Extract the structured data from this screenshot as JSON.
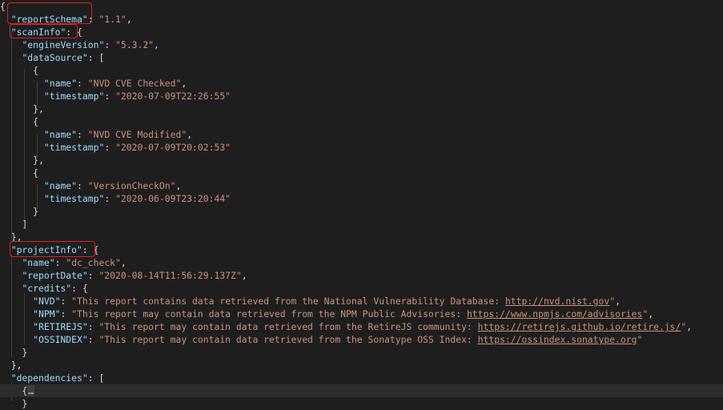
{
  "editor": {
    "lines": [
      {
        "id": "open-brace",
        "segs": [
          {
            "t": "p",
            "v": "{"
          }
        ]
      },
      {
        "id": "report-schema",
        "segs": [
          {
            "t": "p",
            "v": "  "
          },
          {
            "t": "k",
            "v": "\"reportSchema\""
          },
          {
            "t": "p",
            "v": ": "
          },
          {
            "t": "s",
            "v": "\"1.1\""
          },
          {
            "t": "p",
            "v": ","
          }
        ]
      },
      {
        "id": "scan-info",
        "segs": [
          {
            "t": "p",
            "v": "  "
          },
          {
            "t": "k",
            "v": "\"scanInfo\""
          },
          {
            "t": "p",
            "v": ": {"
          }
        ]
      },
      {
        "id": "engine-version",
        "segs": [
          {
            "t": "p",
            "v": "    "
          },
          {
            "t": "k",
            "v": "\"engineVersion\""
          },
          {
            "t": "p",
            "v": ": "
          },
          {
            "t": "s",
            "v": "\"5.3.2\""
          },
          {
            "t": "p",
            "v": ","
          }
        ]
      },
      {
        "id": "data-source",
        "segs": [
          {
            "t": "p",
            "v": "    "
          },
          {
            "t": "k",
            "v": "\"dataSource\""
          },
          {
            "t": "p",
            "v": ": ["
          }
        ]
      },
      {
        "id": "ds1-open",
        "segs": [
          {
            "t": "p",
            "v": "      {"
          }
        ]
      },
      {
        "id": "ds1-name",
        "segs": [
          {
            "t": "p",
            "v": "        "
          },
          {
            "t": "k",
            "v": "\"name\""
          },
          {
            "t": "p",
            "v": ": "
          },
          {
            "t": "s",
            "v": "\"NVD CVE Checked\""
          },
          {
            "t": "p",
            "v": ","
          }
        ]
      },
      {
        "id": "ds1-ts",
        "segs": [
          {
            "t": "p",
            "v": "        "
          },
          {
            "t": "k",
            "v": "\"timestamp\""
          },
          {
            "t": "p",
            "v": ": "
          },
          {
            "t": "s",
            "v": "\"2020-07-09T22:26:55\""
          }
        ]
      },
      {
        "id": "ds1-close",
        "segs": [
          {
            "t": "p",
            "v": "      },"
          }
        ]
      },
      {
        "id": "ds2-open",
        "segs": [
          {
            "t": "p",
            "v": "      {"
          }
        ]
      },
      {
        "id": "ds2-name",
        "segs": [
          {
            "t": "p",
            "v": "        "
          },
          {
            "t": "k",
            "v": "\"name\""
          },
          {
            "t": "p",
            "v": ": "
          },
          {
            "t": "s",
            "v": "\"NVD CVE Modified\""
          },
          {
            "t": "p",
            "v": ","
          }
        ]
      },
      {
        "id": "ds2-ts",
        "segs": [
          {
            "t": "p",
            "v": "        "
          },
          {
            "t": "k",
            "v": "\"timestamp\""
          },
          {
            "t": "p",
            "v": ": "
          },
          {
            "t": "s",
            "v": "\"2020-07-09T20:02:53\""
          }
        ]
      },
      {
        "id": "ds2-close",
        "segs": [
          {
            "t": "p",
            "v": "      },"
          }
        ]
      },
      {
        "id": "ds3-open",
        "segs": [
          {
            "t": "p",
            "v": "      {"
          }
        ]
      },
      {
        "id": "ds3-name",
        "segs": [
          {
            "t": "p",
            "v": "        "
          },
          {
            "t": "k",
            "v": "\"name\""
          },
          {
            "t": "p",
            "v": ": "
          },
          {
            "t": "s",
            "v": "\"VersionCheckOn\""
          },
          {
            "t": "p",
            "v": ","
          }
        ]
      },
      {
        "id": "ds3-ts",
        "segs": [
          {
            "t": "p",
            "v": "        "
          },
          {
            "t": "k",
            "v": "\"timestamp\""
          },
          {
            "t": "p",
            "v": ": "
          },
          {
            "t": "s",
            "v": "\"2020-06-09T23:20:44\""
          }
        ]
      },
      {
        "id": "ds3-close",
        "segs": [
          {
            "t": "p",
            "v": "      }"
          }
        ]
      },
      {
        "id": "ds-array-close",
        "segs": [
          {
            "t": "p",
            "v": "    ]"
          }
        ]
      },
      {
        "id": "scan-info-close",
        "segs": [
          {
            "t": "p",
            "v": "  },"
          }
        ]
      },
      {
        "id": "project-info",
        "segs": [
          {
            "t": "p",
            "v": "  "
          },
          {
            "t": "k",
            "v": "\"projectInfo\""
          },
          {
            "t": "p",
            "v": ": {"
          }
        ]
      },
      {
        "id": "pi-name",
        "segs": [
          {
            "t": "p",
            "v": "    "
          },
          {
            "t": "k",
            "v": "\"name\""
          },
          {
            "t": "p",
            "v": ": "
          },
          {
            "t": "s",
            "v": "\"dc_check\""
          },
          {
            "t": "p",
            "v": ","
          }
        ]
      },
      {
        "id": "pi-report-date",
        "segs": [
          {
            "t": "p",
            "v": "    "
          },
          {
            "t": "k",
            "v": "\"reportDate\""
          },
          {
            "t": "p",
            "v": ": "
          },
          {
            "t": "s",
            "v": "\"2020-08-14T11:56:29.137Z\""
          },
          {
            "t": "p",
            "v": ","
          }
        ]
      },
      {
        "id": "pi-credits",
        "segs": [
          {
            "t": "p",
            "v": "    "
          },
          {
            "t": "k",
            "v": "\"credits\""
          },
          {
            "t": "p",
            "v": ": {"
          }
        ]
      },
      {
        "id": "credit-nvd",
        "segs": [
          {
            "t": "p",
            "v": "      "
          },
          {
            "t": "k",
            "v": "\"NVD\""
          },
          {
            "t": "p",
            "v": ": "
          },
          {
            "t": "s",
            "v": "\"This report contains data retrieved from the National Vulnerability Database: "
          },
          {
            "t": "u",
            "v": "http://nvd.nist.gov"
          },
          {
            "t": "s",
            "v": "\""
          },
          {
            "t": "p",
            "v": ","
          }
        ]
      },
      {
        "id": "credit-npm",
        "segs": [
          {
            "t": "p",
            "v": "      "
          },
          {
            "t": "k",
            "v": "\"NPM\""
          },
          {
            "t": "p",
            "v": ": "
          },
          {
            "t": "s",
            "v": "\"This report may contain data retrieved from the NPM Public Advisories: "
          },
          {
            "t": "u",
            "v": "https://www.npmjs.com/advisories"
          },
          {
            "t": "s",
            "v": "\""
          },
          {
            "t": "p",
            "v": ","
          }
        ]
      },
      {
        "id": "credit-retirejs",
        "segs": [
          {
            "t": "p",
            "v": "      "
          },
          {
            "t": "k",
            "v": "\"RETIREJS\""
          },
          {
            "t": "p",
            "v": ": "
          },
          {
            "t": "s",
            "v": "\"This report may contain data retrieved from the RetireJS community: "
          },
          {
            "t": "u",
            "v": "https://retirejs.github.io/retire.js/"
          },
          {
            "t": "s",
            "v": "\""
          },
          {
            "t": "p",
            "v": ","
          }
        ]
      },
      {
        "id": "credit-ossindex",
        "segs": [
          {
            "t": "p",
            "v": "      "
          },
          {
            "t": "k",
            "v": "\"OSSINDEX\""
          },
          {
            "t": "p",
            "v": ": "
          },
          {
            "t": "s",
            "v": "\"This report may contain data retrieved from the Sonatype OSS Index: "
          },
          {
            "t": "u",
            "v": "https://ossindex.sonatype.org"
          },
          {
            "t": "s",
            "v": "\""
          }
        ]
      },
      {
        "id": "credits-close",
        "segs": [
          {
            "t": "p",
            "v": "    }"
          }
        ]
      },
      {
        "id": "project-info-close",
        "segs": [
          {
            "t": "p",
            "v": "  },"
          }
        ]
      },
      {
        "id": "dependencies",
        "segs": [
          {
            "t": "p",
            "v": "  "
          },
          {
            "t": "k",
            "v": "\"dependencies\""
          },
          {
            "t": "p",
            "v": ": ["
          }
        ]
      },
      {
        "id": "dep-folded",
        "segs": [
          {
            "t": "p",
            "v": "    {"
          },
          {
            "t": "fold",
            "v": "…"
          }
        ]
      },
      {
        "id": "dep-folded-close",
        "segs": [
          {
            "t": "p",
            "v": "    }"
          }
        ]
      }
    ],
    "highlighted_line": "dep-folded"
  },
  "annotations": {
    "color": "#e0201a",
    "boxed_keys": [
      "\"reportSchema\"",
      "\"scanInfo\"",
      "\"projectInfo\""
    ]
  }
}
